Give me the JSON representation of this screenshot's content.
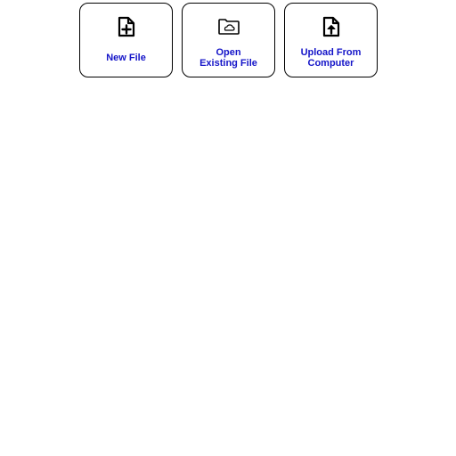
{
  "cards": [
    {
      "id": "new-file",
      "icon": "file-plus-icon",
      "label_lines": [
        "New File"
      ]
    },
    {
      "id": "open-existing-file",
      "icon": "folder-cloud-icon",
      "label_lines": [
        "Open",
        "Existing File"
      ]
    },
    {
      "id": "upload-from-computer",
      "icon": "file-upload-icon",
      "label_lines": [
        "Upload From",
        "Computer"
      ]
    }
  ],
  "colors": {
    "label": "#1414c8",
    "border": "#000000",
    "icon": "#000000"
  }
}
